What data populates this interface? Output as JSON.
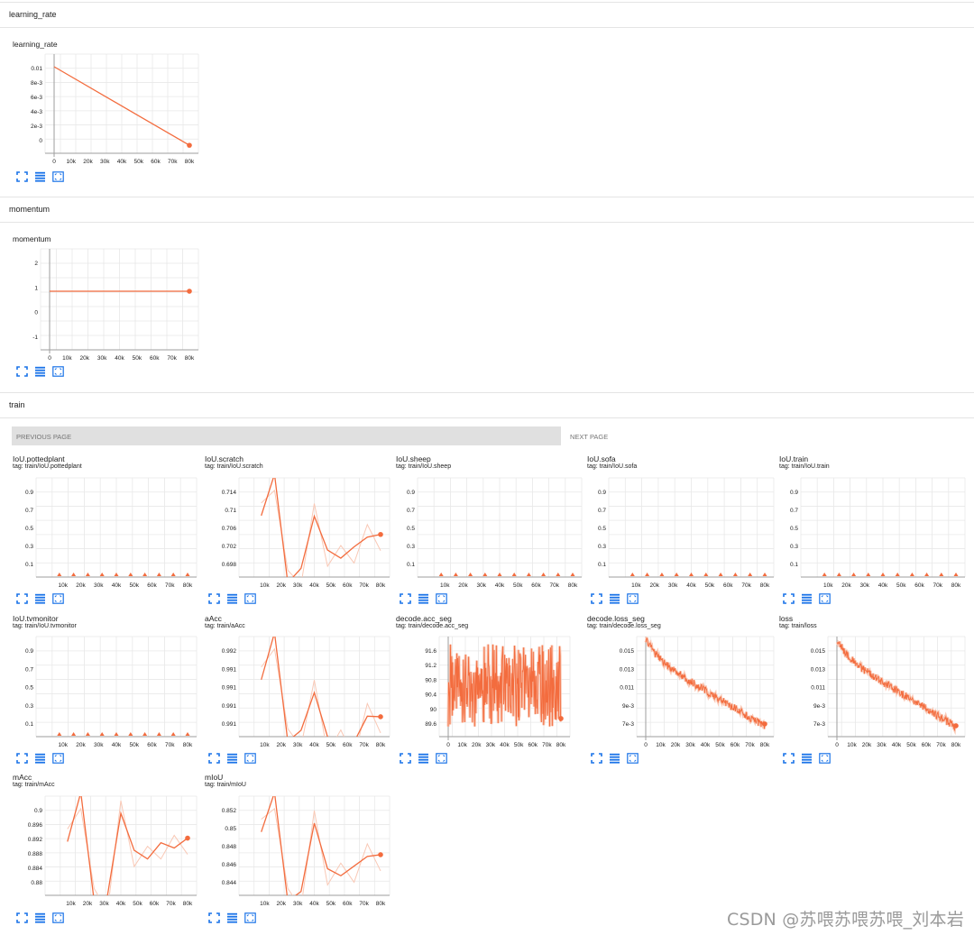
{
  "colors": {
    "series": "#f36c3e",
    "series_faint": "#f9c8b5",
    "grid": "#e8e8e8",
    "axis": "#9e9e9e",
    "icon": "#1a73e8"
  },
  "sections": {
    "learning_rate": "learning_rate",
    "momentum": "momentum",
    "train": "train"
  },
  "pager": {
    "prev_label": "PREVIOUS PAGE",
    "next_label": "NEXT PAGE"
  },
  "icons": [
    "expand-icon",
    "list-icon",
    "fit-domain-icon"
  ],
  "watermark": "CSDN @苏喂苏喂苏喂_刘本岩",
  "panels": [
    {
      "title": "learning_rate",
      "tag": ""
    },
    {
      "title": "momentum",
      "tag": ""
    },
    {
      "title": "IoU.pottedplant",
      "tag": "tag: train/IoU.pottedplant"
    },
    {
      "title": "IoU.scratch",
      "tag": "tag: train/IoU.scratch"
    },
    {
      "title": "IoU.sheep",
      "tag": "tag: train/IoU.sheep"
    },
    {
      "title": "IoU.sofa",
      "tag": "tag: train/IoU.sofa"
    },
    {
      "title": "IoU.train",
      "tag": "tag: train/IoU.train"
    },
    {
      "title": "IoU.tvmonitor",
      "tag": "tag: train/IoU.tvmonitor"
    },
    {
      "title": "aAcc",
      "tag": "tag: train/aAcc"
    },
    {
      "title": "decode.acc_seg",
      "tag": "tag: train/decode.acc_seg"
    },
    {
      "title": "decode.loss_seg",
      "tag": "tag: train/decode.loss_seg"
    },
    {
      "title": "loss",
      "tag": "tag: train/loss"
    },
    {
      "title": "mAcc",
      "tag": "tag: train/mAcc"
    },
    {
      "title": "mIoU",
      "tag": "tag: train/mIoU"
    }
  ],
  "chart_data": [
    {
      "type": "line",
      "name": "learning_rate",
      "xlim": [
        0,
        80000
      ],
      "ylim": [
        0,
        0.01
      ],
      "xticks": [
        "0",
        "10k",
        "20k",
        "30k",
        "40k",
        "50k",
        "60k",
        "70k",
        "80k"
      ],
      "yticks": [
        "0.01",
        "8e-3",
        "6e-3",
        "4e-3",
        "2e-3",
        "0"
      ],
      "x": [
        0,
        80000
      ],
      "y": [
        0.01,
        0.0001
      ]
    },
    {
      "type": "line",
      "name": "momentum",
      "xlim": [
        0,
        80000
      ],
      "ylim": [
        -1,
        2
      ],
      "xticks": [
        "0",
        "10k",
        "20k",
        "30k",
        "40k",
        "50k",
        "60k",
        "70k",
        "80k"
      ],
      "yticks": [
        "2",
        "1",
        "0",
        "-1"
      ],
      "x": [
        0,
        80000
      ],
      "y": [
        0.9,
        0.9
      ]
    },
    {
      "type": "scatter",
      "name": "IoU.pottedplant",
      "xticks": [
        "10k",
        "20k",
        "30k",
        "40k",
        "50k",
        "60k",
        "70k",
        "80k"
      ],
      "yticks": [
        "0.9",
        "0.7",
        "0.5",
        "0.3",
        "0.1"
      ],
      "x": [
        8000,
        16000,
        24000,
        32000,
        40000,
        48000,
        56000,
        64000,
        72000,
        80000
      ],
      "y": [
        0,
        0,
        0,
        0,
        0,
        0,
        0,
        0,
        0,
        0
      ]
    },
    {
      "type": "line",
      "name": "IoU.scratch",
      "xticks": [
        "10k",
        "20k",
        "30k",
        "40k",
        "50k",
        "60k",
        "70k",
        "80k"
      ],
      "yticks": [
        "0.714",
        "0.71",
        "0.706",
        "0.702",
        "0.698"
      ],
      "x": [
        8000,
        16000,
        24000,
        32000,
        40000,
        48000,
        56000,
        64000,
        72000,
        80000
      ],
      "y": [
        0.7083,
        0.716,
        0.6958,
        0.6985,
        0.7082,
        0.7019,
        0.7004,
        0.7025,
        0.7043,
        0.7048
      ]
    },
    {
      "type": "scatter",
      "name": "IoU.sheep",
      "xticks": [
        "10k",
        "20k",
        "30k",
        "40k",
        "50k",
        "60k",
        "70k",
        "80k"
      ],
      "yticks": [
        "0.9",
        "0.7",
        "0.5",
        "0.3",
        "0.1"
      ],
      "x": [
        8000,
        16000,
        24000,
        32000,
        40000,
        48000,
        56000,
        64000,
        72000,
        80000
      ],
      "y": [
        0,
        0,
        0,
        0,
        0,
        0,
        0,
        0,
        0,
        0
      ]
    },
    {
      "type": "scatter",
      "name": "IoU.sofa",
      "xticks": [
        "10k",
        "20k",
        "30k",
        "40k",
        "50k",
        "60k",
        "70k",
        "80k"
      ],
      "yticks": [
        "0.9",
        "0.7",
        "0.5",
        "0.3",
        "0.1"
      ],
      "x": [
        8000,
        16000,
        24000,
        32000,
        40000,
        48000,
        56000,
        64000,
        72000,
        80000
      ],
      "y": [
        0,
        0,
        0,
        0,
        0,
        0,
        0,
        0,
        0,
        0
      ]
    },
    {
      "type": "scatter",
      "name": "IoU.train",
      "xticks": [
        "10k",
        "20k",
        "30k",
        "40k",
        "50k",
        "60k",
        "70k",
        "80k"
      ],
      "yticks": [
        "0.9",
        "0.7",
        "0.5",
        "0.3",
        "0.1"
      ],
      "x": [
        8000,
        16000,
        24000,
        32000,
        40000,
        48000,
        56000,
        64000,
        72000,
        80000
      ],
      "y": [
        0,
        0,
        0,
        0,
        0,
        0,
        0,
        0,
        0,
        0
      ]
    },
    {
      "type": "scatter",
      "name": "IoU.tvmonitor",
      "xticks": [
        "10k",
        "20k",
        "30k",
        "40k",
        "50k",
        "60k",
        "70k",
        "80k"
      ],
      "yticks": [
        "0.9",
        "0.7",
        "0.5",
        "0.3",
        "0.1"
      ],
      "x": [
        8000,
        16000,
        24000,
        32000,
        40000,
        48000,
        56000,
        64000,
        72000,
        80000
      ],
      "y": [
        0,
        0,
        0,
        0,
        0,
        0,
        0,
        0,
        0,
        0
      ]
    },
    {
      "type": "line",
      "name": "aAcc",
      "xticks": [
        "10k",
        "20k",
        "30k",
        "40k",
        "50k",
        "60k",
        "70k",
        "80k"
      ],
      "yticks": [
        "0.992",
        "0.991",
        "0.991",
        "0.991",
        "0.991"
      ],
      "x": [
        8000,
        16000,
        24000,
        32000,
        40000,
        48000,
        56000,
        64000,
        72000,
        80000
      ],
      "y": [
        0.9918,
        0.9926,
        0.99075,
        0.99094,
        0.99158,
        0.99083,
        0.99073,
        0.99074,
        0.99118,
        0.99117
      ]
    },
    {
      "type": "line",
      "name": "decode.acc_seg",
      "noisy": true,
      "xticks": [
        "0",
        "10k",
        "20k",
        "30k",
        "40k",
        "50k",
        "60k",
        "70k",
        "80k"
      ],
      "yticks": [
        "91.6",
        "91.2",
        "90.8",
        "90.4",
        "90",
        "89.6"
      ],
      "range": [
        89.5,
        91.7
      ],
      "center": 90.6,
      "end": 90.9
    },
    {
      "type": "line",
      "name": "decode.loss_seg",
      "noisy": true,
      "xticks": [
        "0",
        "10k",
        "20k",
        "30k",
        "40k",
        "50k",
        "60k",
        "70k",
        "80k"
      ],
      "yticks": [
        "0.015",
        "0.013",
        "0.011",
        "9e-3",
        "7e-3"
      ],
      "start": 0.0172,
      "end": 0.0072
    },
    {
      "type": "line",
      "name": "loss",
      "noisy": true,
      "xticks": [
        "0",
        "10k",
        "20k",
        "30k",
        "40k",
        "50k",
        "60k",
        "70k",
        "80k"
      ],
      "yticks": [
        "0.015",
        "0.013",
        "0.011",
        "9e-3",
        "7e-3"
      ],
      "start": 0.0172,
      "end": 0.0072
    },
    {
      "type": "line",
      "name": "mAcc",
      "xticks": [
        "10k",
        "20k",
        "30k",
        "40k",
        "50k",
        "60k",
        "70k",
        "80k"
      ],
      "yticks": [
        "0.9",
        "0.896",
        "0.892",
        "0.888",
        "0.884",
        "0.88"
      ],
      "x": [
        8000,
        16000,
        24000,
        32000,
        40000,
        48000,
        56000,
        64000,
        72000,
        80000
      ],
      "y": [
        0.8925,
        0.901,
        0.8822,
        0.8832,
        0.8974,
        0.891,
        0.8895,
        0.8923,
        0.8914,
        0.8931
      ]
    },
    {
      "type": "line",
      "name": "mIoU",
      "xticks": [
        "10k",
        "20k",
        "30k",
        "40k",
        "50k",
        "60k",
        "70k",
        "80k"
      ],
      "yticks": [
        "0.852",
        "0.85",
        "0.848",
        "0.846",
        "0.844"
      ],
      "x": [
        8000,
        16000,
        24000,
        32000,
        40000,
        48000,
        56000,
        64000,
        72000,
        80000
      ],
      "y": [
        0.8505,
        0.855,
        0.8426,
        0.8437,
        0.8515,
        0.8463,
        0.8455,
        0.8466,
        0.8477,
        0.8479
      ]
    }
  ]
}
